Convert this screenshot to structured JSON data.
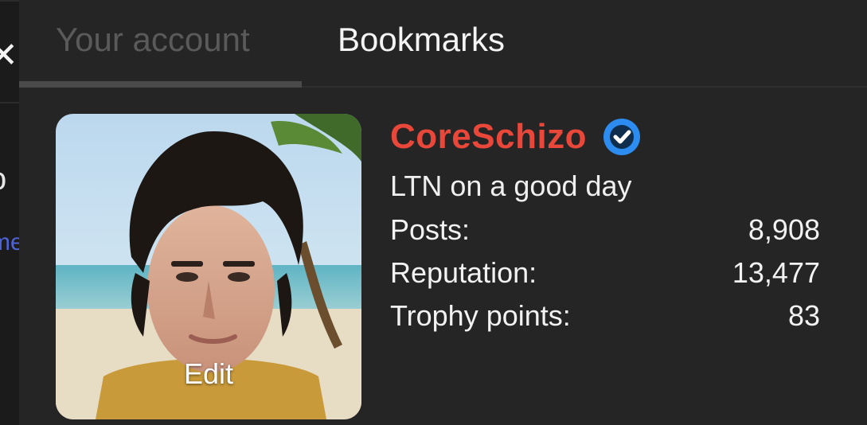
{
  "tabs": [
    {
      "label": "Your account",
      "active": true
    },
    {
      "label": "Bookmarks",
      "active": false
    }
  ],
  "left_strip": {
    "close_icon": "close-icon",
    "fragment_text": "o",
    "fragment_link": "me"
  },
  "profile": {
    "avatar_edit_label": "Edit",
    "username": "CoreSchizo",
    "username_color": "#e8473a",
    "verified_icon": "verified-check-icon",
    "verified_color": "#2d8cf0",
    "tagline": "LTN on a good day",
    "stats": [
      {
        "label": "Posts:",
        "value": "8,908"
      },
      {
        "label": "Reputation:",
        "value": "13,477"
      },
      {
        "label": "Trophy points:",
        "value": "83"
      }
    ]
  }
}
